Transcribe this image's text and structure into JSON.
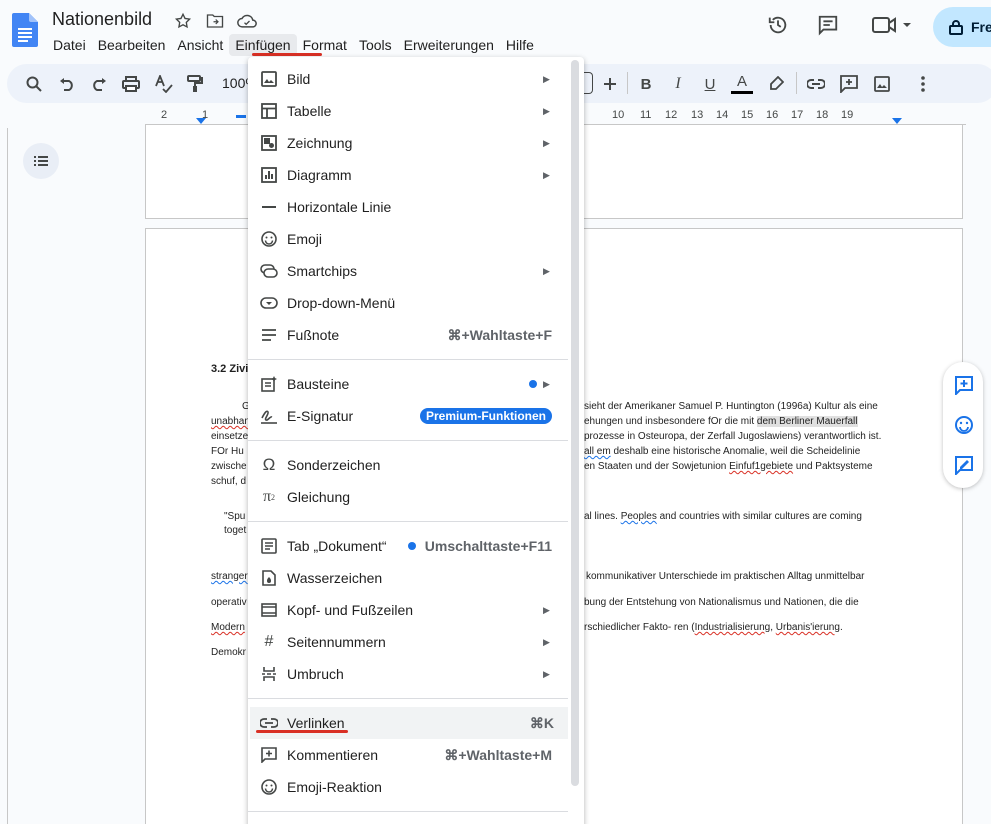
{
  "doc": {
    "title": "Nationenbild",
    "share_label": "Fre"
  },
  "menubar": [
    "Datei",
    "Bearbeiten",
    "Ansicht",
    "Einfügen",
    "Format",
    "Tools",
    "Erweiterungen",
    "Hilfe"
  ],
  "toolbar": {
    "zoom": "100%"
  },
  "ruler": [
    "2",
    "1",
    "10",
    "11",
    "12",
    "13",
    "14",
    "15",
    "16",
    "17",
    "18",
    "19"
  ],
  "insert_menu": {
    "items": [
      {
        "icon": "image-icon",
        "label": "Bild",
        "submenu": true
      },
      {
        "icon": "table-icon",
        "label": "Tabelle",
        "submenu": true
      },
      {
        "icon": "drawing-icon",
        "label": "Zeichnung",
        "submenu": true
      },
      {
        "icon": "chart-icon",
        "label": "Diagramm",
        "submenu": true
      },
      {
        "icon": "horizontal-line-icon",
        "label": "Horizontale Linie",
        "submenu": false
      },
      {
        "icon": "emoji-icon",
        "label": "Emoji",
        "submenu": false
      },
      {
        "icon": "smartchips-icon",
        "label": "Smartchips",
        "submenu": true
      },
      {
        "icon": "dropdown-icon",
        "label": "Drop-down-Menü",
        "submenu": false
      },
      {
        "icon": "footnote-icon",
        "label": "Fußnote",
        "shortcut": "⌘+Wahltaste+F"
      },
      {
        "icon": "building-blocks-icon",
        "label": "Bausteine",
        "submenu": true,
        "dot": true
      },
      {
        "icon": "esignature-icon",
        "label": "E-Signatur",
        "badge": "Premium-Funktionen"
      },
      {
        "icon": "omega-icon",
        "label": "Sonderzeichen",
        "submenu": false
      },
      {
        "icon": "pi-icon",
        "label": "Gleichung",
        "submenu": false
      },
      {
        "icon": "document-tab-icon",
        "label": "Tab „Dokument“",
        "shortcut": "Umschalttaste+F11",
        "dot": true
      },
      {
        "icon": "watermark-icon",
        "label": "Wasserzeichen",
        "submenu": false
      },
      {
        "icon": "header-footer-icon",
        "label": "Kopf- und Fußzeilen",
        "submenu": true
      },
      {
        "icon": "page-number-icon",
        "label": "Seitennummern",
        "submenu": true
      },
      {
        "icon": "break-icon",
        "label": "Umbruch",
        "submenu": true
      },
      {
        "icon": "link-icon",
        "label": "Verlinken",
        "shortcut": "⌘K"
      },
      {
        "icon": "comment-icon",
        "label": "Kommentieren",
        "shortcut": "⌘+Wahltaste+M"
      },
      {
        "icon": "emoji-reaction-icon",
        "label": "Emoji-Reaktion",
        "submenu": false
      }
    ]
  },
  "page_text": {
    "heading": "3.2 Zivi",
    "l1a": "G",
    "l1b": "sieht der Amerikaner Samuel P. Huntington (1996a) Kultur als eine",
    "l2a": "unabhan",
    "l2b": "ehungen und insbesondere fOr die mit",
    "l2c": "dem Berliner Mauerfall",
    "l3a": "einsetze",
    "l3b": "prozesse in Osteuropa, der Zerfall Jugoslawiens) verantwortlich ist.",
    "l4a": "FOr Hu",
    "l4b": "all em",
    "l4c": " deshalb eine historische Anomalie, weil die Scheidelinie",
    "l5a": "zwische",
    "l5b": "en Staaten und der Sowjetunion ",
    "l5c": "Einfuf1gebiete",
    "l5d": " und Paktsysteme",
    "l6a": "schuf, d",
    "q1a": "\"Spu",
    "q1b": "al lines. ",
    "q1c": "Peoples",
    "q1d": " and countries with similar cultures are coming",
    "q2a": "toget",
    "p1a": "stranger",
    "p1b": "kommunikativer",
    "p1c": " Unterschiede im praktischen Alltag unmittelbar",
    "p2a": "operativ",
    "p2b": "bung der Entstehung von Nationalismus und Nationen, die die",
    "p3a": "Modern",
    "p3b": "rschiedlicher Fakto- ren (",
    "p3c": "Industrialisierung",
    "p3d": ", ",
    "p3e": "Urbanis'ierung",
    "p3f": ".",
    "p4a": "Demokr"
  }
}
